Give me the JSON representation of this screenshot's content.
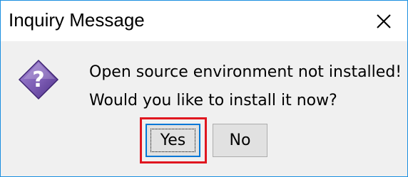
{
  "dialog": {
    "title": "Inquiry Message",
    "close_icon": "close-icon",
    "icon": "question-icon",
    "message_line1": "Open source environment not installed!",
    "message_line2": "Would you like to install it now?"
  },
  "buttons": {
    "yes_label": "Yes",
    "no_label": "No"
  },
  "colors": {
    "border": "#1b8fe0",
    "dialog_bg": "#f0f0f0",
    "default_button_border": "#0078d7",
    "highlight": "#e0161f",
    "icon_purple": "#7b5bb3"
  }
}
